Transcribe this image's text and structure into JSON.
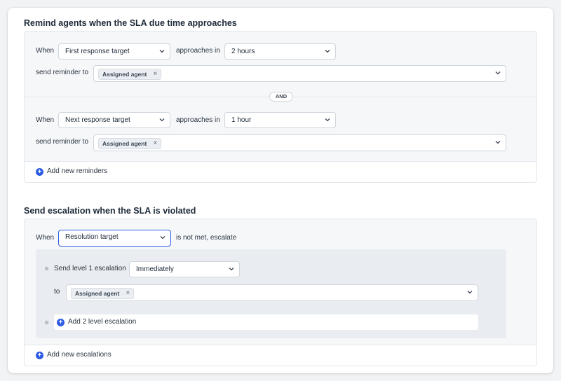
{
  "reminders": {
    "title": "Remind agents when the SLA due time approaches",
    "rows": [
      {
        "when_label": "When",
        "target": "First response target",
        "approaches_label": "approaches in",
        "time": "2 hours",
        "send_label": "send reminder to",
        "recipient": "Assigned agent"
      },
      {
        "when_label": "When",
        "target": "Next response target",
        "approaches_label": "approaches in",
        "time": "1 hour",
        "send_label": "send reminder to",
        "recipient": "Assigned agent"
      }
    ],
    "and_label": "AND",
    "add_label": "Add new reminders"
  },
  "escalation": {
    "title": "Send escalation when the SLA is violated",
    "when_label": "When",
    "target": "Resolution target",
    "not_met_label": "is not met, escalate",
    "level1_label": "Send level 1 escalation",
    "level1_time": "Immediately",
    "to_label": "to",
    "recipient": "Assigned agent",
    "add_level_label": "Add 2 level escalation",
    "add_label": "Add new escalations"
  },
  "icons": {
    "chevron": "chevron-down-icon",
    "remove": "close-icon",
    "add": "plus-circle-icon"
  },
  "colors": {
    "accent": "#2d5be3"
  }
}
